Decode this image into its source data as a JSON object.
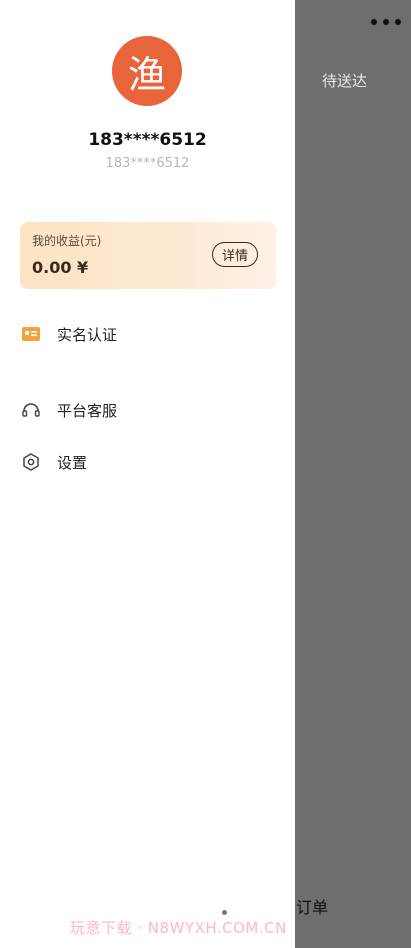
{
  "background": {
    "tab_label": "待送达",
    "bottom_label": "订单"
  },
  "profile": {
    "avatar_text": "渔",
    "phone_masked": "183****6512",
    "phone_masked_sub": "183****6512"
  },
  "earnings": {
    "label": "我的收益(元)",
    "value": "0.00 ¥",
    "details_button": "详情"
  },
  "menu": {
    "items": [
      {
        "label": "实名认证",
        "icon": "id-card-icon"
      },
      {
        "label": "平台客服",
        "icon": "headset-icon"
      },
      {
        "label": "设置",
        "icon": "settings-icon"
      }
    ]
  },
  "watermark": "玩意下载 · N8WYXH.COM.CN",
  "colors": {
    "avatar": "#e8643a",
    "card_start": "#fde3c3",
    "card_end": "#fff1e6",
    "overlay": "#6f7072"
  }
}
